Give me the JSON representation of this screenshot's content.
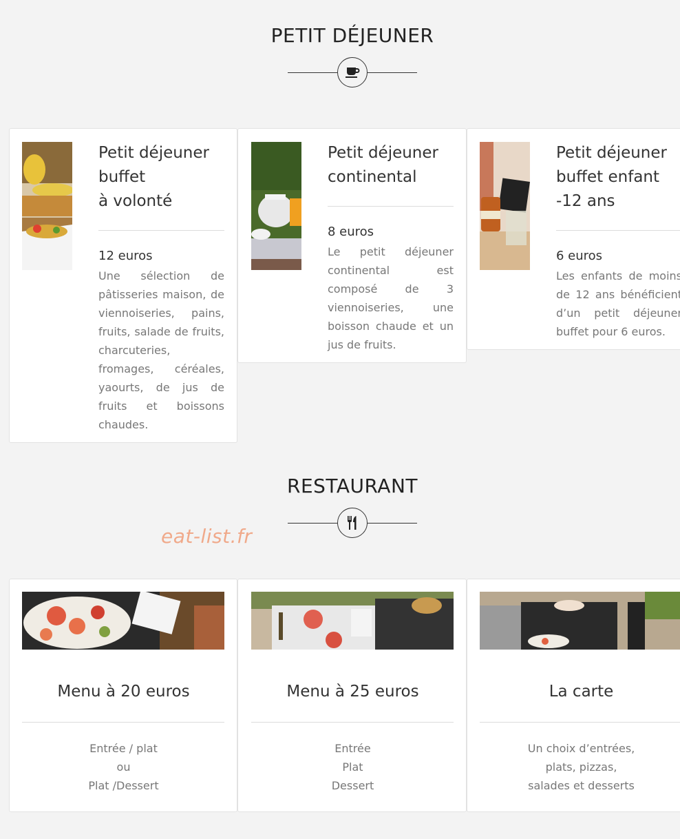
{
  "breakfast": {
    "title": "PETIT DÉJEUNER",
    "icon": "coffee-cup-icon",
    "cards": [
      {
        "title": "Petit déjeuner\nbuffet\nà volonté",
        "price": "12 euros",
        "description": "Une sélection de pâtisseries maison, de viennoiseries, pains, fruits, salade de fruits, charcuteries, fromages, céréales, yaourts, de jus de fruits et boissons chaudes.",
        "image": "fruit-basket-photo"
      },
      {
        "title": "Petit déjeuner\ncontinental",
        "price": "8 euros",
        "description": "Le petit déjeuner continental est composé de 3 viennoiseries, une boisson chaude et un jus de fruits.",
        "image": "teapot-photo"
      },
      {
        "title": "Petit déjeuner\nbuffet enfant\n-12 ans",
        "price": "6 euros",
        "description": "Les enfants de moins de 12 ans bénéficient d’un petit déjeuner buffet pour 6 euros.",
        "image": "juice-jars-photo"
      }
    ]
  },
  "restaurant": {
    "title": "RESTAURANT",
    "icon": "fork-knife-icon",
    "watermark": "eat-list.fr",
    "cards": [
      {
        "title": "Menu à 20 euros",
        "description": "Entrée / plat\nou\nPlat /Dessert",
        "image": "salad-plate-photo"
      },
      {
        "title": "Menu à 25 euros",
        "description": "Entrée\nPlat\nDessert",
        "image": "terrace-table-photo"
      },
      {
        "title": "La carte",
        "description": "Un choix d’entrées,\nplats, pizzas,\nsalades et desserts",
        "image": "outdoor-dining-photo"
      }
    ]
  },
  "colors": {
    "background": "#f3f3f3",
    "card": "#ffffff",
    "watermark": "#f0a98a"
  }
}
